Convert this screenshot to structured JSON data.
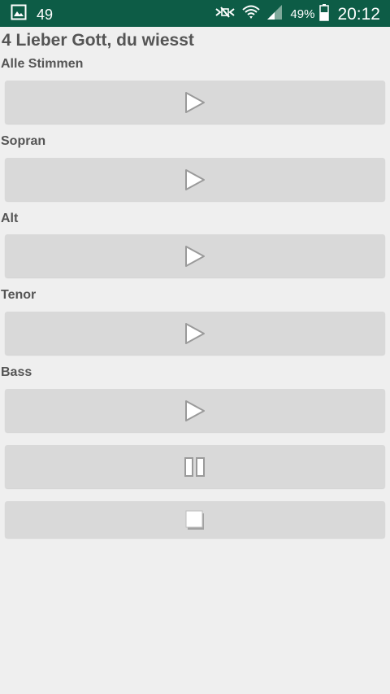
{
  "status_bar": {
    "notification_count": "49",
    "battery_percent": "49%",
    "time": "20:12",
    "background": "#0d5c46",
    "icons": [
      "image-notification-icon",
      "mute-icon",
      "wifi-icon",
      "signal-icon",
      "battery-icon"
    ]
  },
  "song": {
    "title": "4 Lieber Gott, du wiesst"
  },
  "voices": [
    {
      "label": "Alle Stimmen",
      "button_icon": "play-icon"
    },
    {
      "label": "Sopran",
      "button_icon": "play-icon"
    },
    {
      "label": "Alt",
      "button_icon": "play-icon"
    },
    {
      "label": "Tenor",
      "button_icon": "play-icon"
    },
    {
      "label": "Bass",
      "button_icon": "play-icon"
    }
  ],
  "controls": {
    "pause_icon": "pause-icon",
    "stop_icon": "stop-icon"
  },
  "colors": {
    "page_background": "#efefef",
    "button_background": "#d9d9d9",
    "label_text": "#555555"
  }
}
